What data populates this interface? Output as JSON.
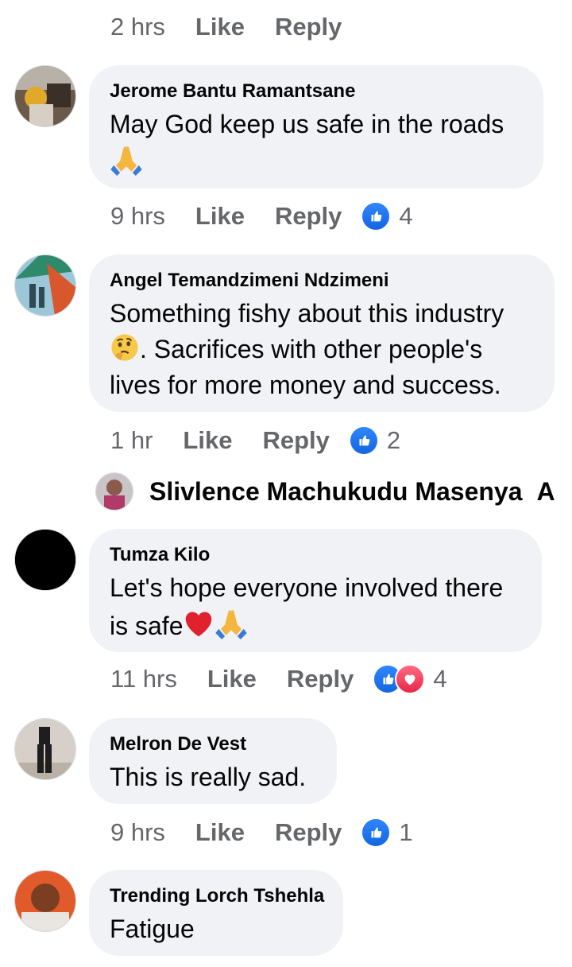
{
  "meta_rows": [
    {
      "time": "2 hrs",
      "like": "Like",
      "reply": "Reply"
    },
    {
      "time": "9 hrs",
      "like": "Like",
      "reply": "Reply",
      "reaction_count": "4"
    },
    {
      "time": "1 hr",
      "like": "Like",
      "reply": "Reply",
      "reaction_count": "2"
    },
    {
      "time": "11 hrs",
      "like": "Like",
      "reply": "Reply",
      "reaction_count": "4"
    },
    {
      "time": "9 hrs",
      "like": "Like",
      "reply": "Reply",
      "reaction_count": "1"
    }
  ],
  "comments": [
    {
      "author": "Jerome Bantu Ramantsane",
      "text": "May God keep us safe in the roads",
      "emoji": "folded-hands"
    },
    {
      "author": "Angel Temandzimeni Ndzimeni",
      "text_emoji_prefix": "thinking-face",
      "text_before_emoji": "Something fishy about this industry",
      "text_after_emoji": ". Sacrifices with other people's lives for more money and success."
    },
    {
      "author": "Tumza Kilo",
      "text": "Let's hope everyone involved there is safe",
      "emojis": [
        "red-heart",
        "folded-hands"
      ]
    },
    {
      "author": "Melron De Vest",
      "text": "This is really sad."
    },
    {
      "author": "Trending Lorch Tshehla",
      "text": "Fatigue"
    }
  ],
  "collapsed_reply": {
    "author": "Slivlence Machukudu Masenya",
    "trailing": "A"
  },
  "colors": {
    "bubble": "#f0f2f5",
    "meta_text": "#65676b",
    "like_blue": "#1877f2",
    "love_red": "#f33e58"
  }
}
